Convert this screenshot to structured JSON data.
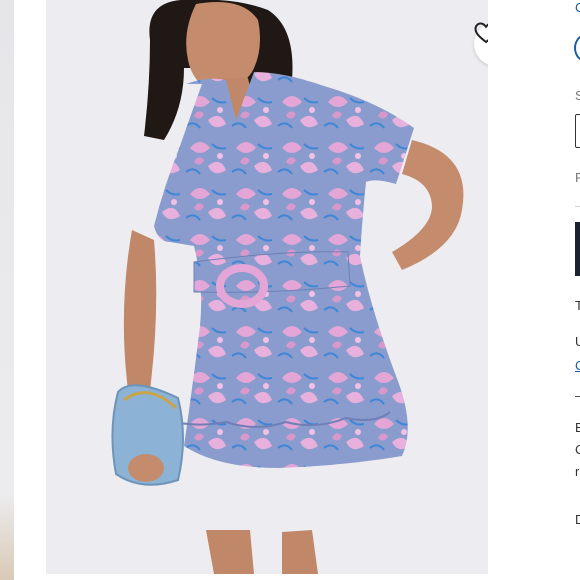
{
  "listing": {
    "favorite_label": "Like"
  },
  "right_panel": {
    "fragments": [
      "C",
      "S",
      "F",
      "T",
      "U",
      "C",
      "–",
      "E",
      "C",
      "r",
      "D"
    ]
  },
  "colors": {
    "photo_background": "#ededf1",
    "dress_base": "#8a9ccd",
    "dress_flower": "#e3a6d6",
    "dress_accent": "#3f86d6",
    "bag": "#8cb3d5",
    "cta": "#1c2330"
  },
  "icons": {
    "favorite": "heart-icon"
  }
}
